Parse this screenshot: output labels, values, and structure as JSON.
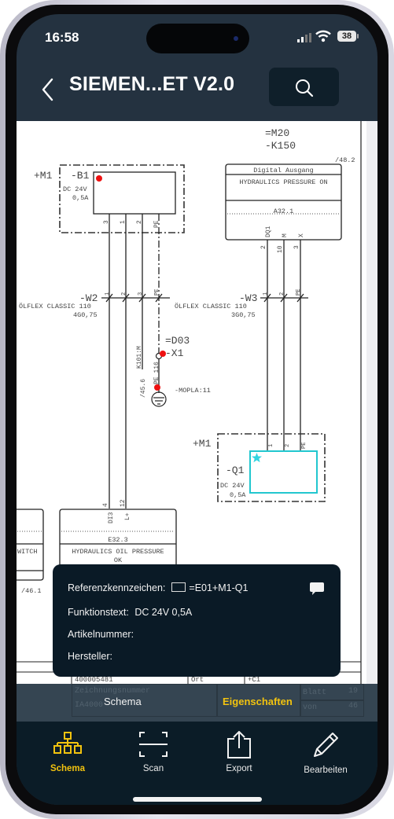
{
  "status_bar": {
    "time": "16:58",
    "battery": "38",
    "signal_icon": "cellular-signal-icon",
    "wifi_icon": "wifi-icon"
  },
  "nav": {
    "title": "SIEMEN...ET V2.0",
    "back_icon": "chevron-left-icon",
    "search_icon": "search-icon"
  },
  "schematic": {
    "device_b1": {
      "location": "+M1",
      "tag": "-B1",
      "rating1": "DC 24V",
      "rating2": "0,5A",
      "pins": [
        "3",
        "1",
        "2",
        "PE"
      ]
    },
    "plc_k150": {
      "function": "=M20",
      "tag": "-K150",
      "page_ref": "/48.2",
      "header": "Digital Ausgang",
      "text": "HYDRAULICS PRESSURE ON",
      "address": "A32.1",
      "pins": [
        "DQ1",
        "M",
        "X"
      ],
      "wire_numbers": [
        "2",
        "10",
        "3"
      ]
    },
    "cable_w2": {
      "tag": "-W2",
      "type": "ÖLFLEX CLASSIC 110",
      "spec": "4G0,75",
      "cores": [
        "1",
        "2",
        "3",
        "PE"
      ]
    },
    "cable_w3": {
      "tag": "-W3",
      "type": "ÖLFLEX CLASSIC 110",
      "spec": "3G0,75",
      "cores": [
        "1",
        "2",
        "PE"
      ]
    },
    "terminal": {
      "function": "=D03",
      "tag": "-X1",
      "wire_label": "K101:M",
      "pe_label": "PE 116",
      "page_ref": "/45.6",
      "ground_label": "-MOPLA:11"
    },
    "device_q1": {
      "location": "+M1",
      "tag": "-Q1",
      "rating1": "DC 24V",
      "rating2": "0,5A",
      "pins": [
        "1",
        "2",
        "PE"
      ]
    },
    "plc_e32": {
      "pins": [
        "DI3",
        "L+"
      ],
      "wire_numbers": [
        "4",
        "12"
      ],
      "address": "E32.3",
      "text1": "HYDRAULICS OIL PRESSURE",
      "text2": "OK"
    },
    "left_partial": {
      "text": "WITCH",
      "page_ref": "/46.1"
    },
    "title_block": {
      "doc_no": "400005481",
      "ort_label": "Ort",
      "ort_value": "+C1",
      "drawing_label": "Zeichnungsnummer",
      "drawing_value": "IA4000",
      "blatt_label": "Blatt",
      "blatt_value": "19",
      "von_label": "von",
      "von_value": "46"
    }
  },
  "popup": {
    "ref_label": "Referenzkennzeichen:",
    "ref_value": "=E01+M1-Q1",
    "func_label": "Funktionstext:",
    "func_value": "DC 24V 0,5A",
    "article_label": "Artikelnummer:",
    "article_value": "",
    "maker_label": "Hersteller:",
    "maker_value": "",
    "comment_icon": "comment-icon"
  },
  "segment": {
    "schema_label": "Schema",
    "props_label": "Eigenschaften",
    "active": "Eigenschaften",
    "active_color": "#f2c30f"
  },
  "tabbar": {
    "active_color": "#f2c30f",
    "items": [
      {
        "label": "Schema",
        "icon": "hierarchy-icon",
        "active": true
      },
      {
        "label": "Scan",
        "icon": "scan-icon",
        "active": false
      },
      {
        "label": "Export",
        "icon": "share-icon",
        "active": false
      },
      {
        "label": "Bearbeiten",
        "icon": "pencil-icon",
        "active": false
      }
    ]
  }
}
